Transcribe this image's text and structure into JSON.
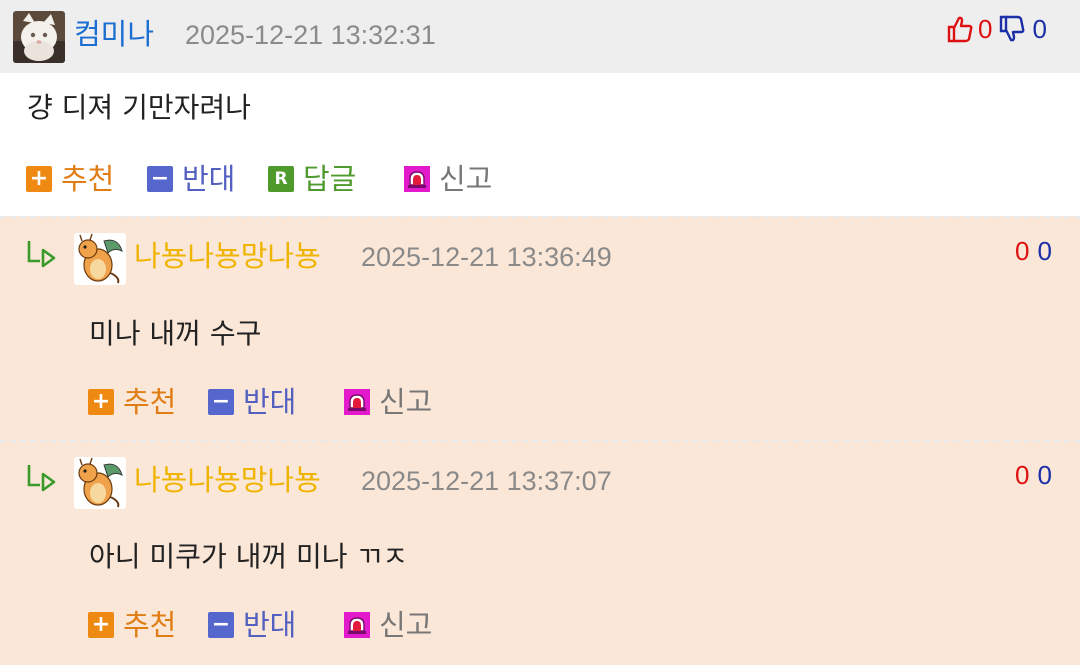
{
  "comments": [
    {
      "nickname": "컴미나",
      "date": "2025-12-21 13:32:31",
      "body": "걍 디져 기만자려나",
      "upvotes": "0",
      "downvotes": "0",
      "actions": {
        "recommend": "추천",
        "oppose": "반대",
        "reply": "답글",
        "report": "신고"
      },
      "avatar_icon": "white-cat-avatar",
      "thumbs_up_icon": "thumbs-up-icon",
      "thumbs_down_icon": "thumbs-down-icon"
    },
    {
      "nickname": "나뇽나뇽망나뇽",
      "date": "2025-12-21 13:36:49",
      "body": "미나 내꺼 수구",
      "upvotes": "0",
      "downvotes": "0",
      "actions": {
        "recommend": "추천",
        "oppose": "반대",
        "report": "신고"
      },
      "avatar_icon": "dragonite-avatar",
      "reply_indicator_icon": "reply-arrow-icon"
    },
    {
      "nickname": "나뇽나뇽망나뇽",
      "date": "2025-12-21 13:37:07",
      "body": "아니 미쿠가 내꺼 미나 ㄲㅈ",
      "upvotes": "0",
      "downvotes": "0",
      "actions": {
        "recommend": "추천",
        "oppose": "반대",
        "report": "신고"
      },
      "avatar_icon": "dragonite-avatar",
      "reply_indicator_icon": "reply-arrow-icon"
    }
  ],
  "colors": {
    "header_bg": "#eeeeee",
    "reply_bg": "#fbe7d8",
    "nick_blue": "#1a6fd0",
    "nick_yellow": "#f0b400",
    "recommend_orange": "#e07d14",
    "oppose_blue": "#5360c0",
    "reply_green": "#4f9a2c",
    "up_red": "#dd1111",
    "down_blue": "#1a2fa8"
  }
}
